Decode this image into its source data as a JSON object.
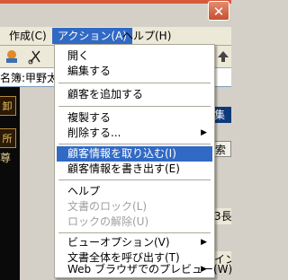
{
  "menubar": {
    "items": [
      {
        "label": "作成(C)",
        "active": false
      },
      {
        "label": "アクション(A)",
        "active": true
      },
      {
        "label": "ヘルプ(H)",
        "active": false
      }
    ]
  },
  "window": {
    "close_glyph": "✕"
  },
  "namerow": {
    "label": "名簿:甲野太"
  },
  "darkpane": {
    "btn1": "卸",
    "btn2": "所",
    "char": "尊"
  },
  "rightpane": {
    "frag1": "集",
    "frag2": "索",
    "frag3": "3長",
    "frag4": "イン"
  },
  "action_menu": {
    "items": [
      {
        "label": "開く"
      },
      {
        "label": "編集する"
      },
      {
        "label": "顧客を追加する"
      },
      {
        "label": "複製する"
      },
      {
        "label": "削除する..."
      },
      {
        "label": "顧客情報を取り込む(I)"
      },
      {
        "label": "顧客情報を書き出す(E)"
      },
      {
        "label": "ヘルプ"
      },
      {
        "label": "文書のロック(L)"
      },
      {
        "label": "ロックの解除(U)"
      },
      {
        "label": "ビューオプション(V)"
      },
      {
        "label": "文書全体を呼び出す(T)"
      },
      {
        "label": "Web ブラウザでのプレビュー(W)"
      }
    ],
    "highlight_index": 5,
    "submenu_arrow": "▶"
  },
  "colors": {
    "highlight": "#316ac5",
    "menu_border": "#aca899",
    "disabled": "#a0a0a0"
  },
  "icons": [
    "user-icon",
    "cut-icon",
    "arrow-icon"
  ]
}
